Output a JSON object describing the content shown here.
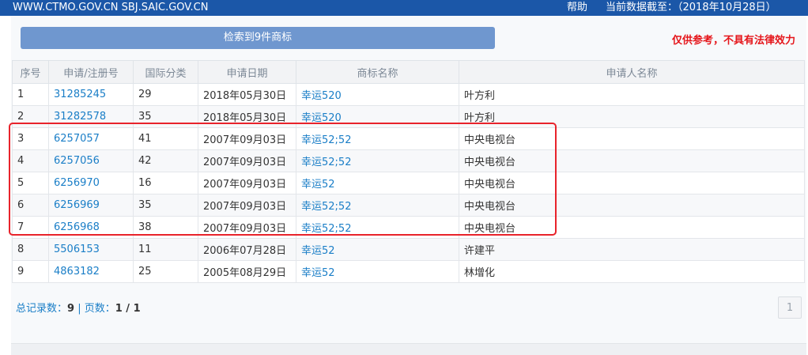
{
  "header": {
    "sites": "WWW.CTMO.GOV.CN SBJ.SAIC.GOV.CN",
    "help": "帮助",
    "data_date": "当前数据截至：（2018年10月28日）"
  },
  "search": {
    "result_label": "检索到9件商标",
    "disclaimer": "仅供参考，不具有法律效力"
  },
  "table": {
    "columns": [
      "序号",
      "申请/注册号",
      "国际分类",
      "申请日期",
      "商标名称",
      "申请人名称"
    ],
    "rows": [
      {
        "no": "1",
        "reg": "31285245",
        "cls": "29",
        "date": "2018年05月30日",
        "name": "幸运520",
        "applicant": "叶方利"
      },
      {
        "no": "2",
        "reg": "31282578",
        "cls": "35",
        "date": "2018年05月30日",
        "name": "幸运520",
        "applicant": "叶方利"
      },
      {
        "no": "3",
        "reg": "6257057",
        "cls": "41",
        "date": "2007年09月03日",
        "name": "幸运52;52",
        "applicant": "中央电视台"
      },
      {
        "no": "4",
        "reg": "6257056",
        "cls": "42",
        "date": "2007年09月03日",
        "name": "幸运52;52",
        "applicant": "中央电视台"
      },
      {
        "no": "5",
        "reg": "6256970",
        "cls": "16",
        "date": "2007年09月03日",
        "name": "幸运52",
        "applicant": "中央电视台"
      },
      {
        "no": "6",
        "reg": "6256969",
        "cls": "35",
        "date": "2007年09月03日",
        "name": "幸运52;52",
        "applicant": "中央电视台"
      },
      {
        "no": "7",
        "reg": "6256968",
        "cls": "38",
        "date": "2007年09月03日",
        "name": "幸运52;52",
        "applicant": "中央电视台"
      },
      {
        "no": "8",
        "reg": "5506153",
        "cls": "11",
        "date": "2006年07月28日",
        "name": "幸运52",
        "applicant": "许建平"
      },
      {
        "no": "9",
        "reg": "4863182",
        "cls": "25",
        "date": "2005年08月29日",
        "name": "幸运52",
        "applicant": "林增化"
      }
    ]
  },
  "pager": {
    "total_label": "总记录数：",
    "total": "9",
    "sep": " | ",
    "pages_label": "页数：",
    "pages": "1 / 1",
    "page_button": "1"
  },
  "colors": {
    "header_bg": "#1b57a8",
    "link": "#1a7ec7",
    "highlight": "#e8232b",
    "disclaimer": "#e5151a"
  }
}
